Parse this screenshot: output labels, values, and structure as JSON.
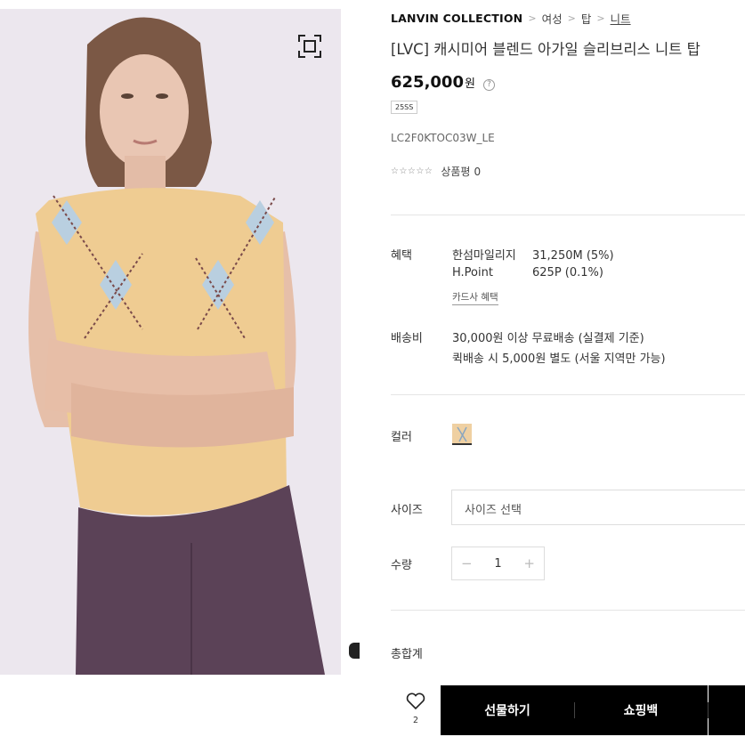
{
  "breadcrumb": {
    "brand": "LANVIN COLLECTION",
    "items": [
      "여성",
      "탑"
    ],
    "current": "니트"
  },
  "product": {
    "title": "[LVC] 캐시미어 블렌드 아가일 슬리브리스 니트 탑",
    "price": "625,000",
    "currency": "원",
    "season": "25SS",
    "code": "LC2F0KTOC03W_LE",
    "stars": "☆☆☆☆☆",
    "review_label": "상품평",
    "review_count": "0"
  },
  "benefits": {
    "label": "혜택",
    "rows": [
      {
        "name": "한섬마일리지",
        "value": "31,250M (5%)"
      },
      {
        "name": "H.Point",
        "value": "625P (0.1%)"
      }
    ],
    "card_link": "카드사 혜택"
  },
  "shipping": {
    "label": "배송비",
    "line1": "30,000원 이상 무료배송 (실결제 기준)",
    "line2": "퀵배송 시 5,000원 별도 (서울 지역만 가능)"
  },
  "color": {
    "label": "컬러",
    "swatch": "#efd0a2"
  },
  "size": {
    "label": "사이즈",
    "placeholder": "사이즈 선택"
  },
  "quantity": {
    "label": "수량",
    "minus": "−",
    "value": "1",
    "plus": "+"
  },
  "total": {
    "label": "총합계"
  },
  "actions": {
    "wish_count": "2",
    "gift": "선물하기",
    "bag": "쇼핑백"
  },
  "icons": {
    "expand": "expand-icon",
    "info": "info-icon",
    "heart": "heart-icon"
  }
}
